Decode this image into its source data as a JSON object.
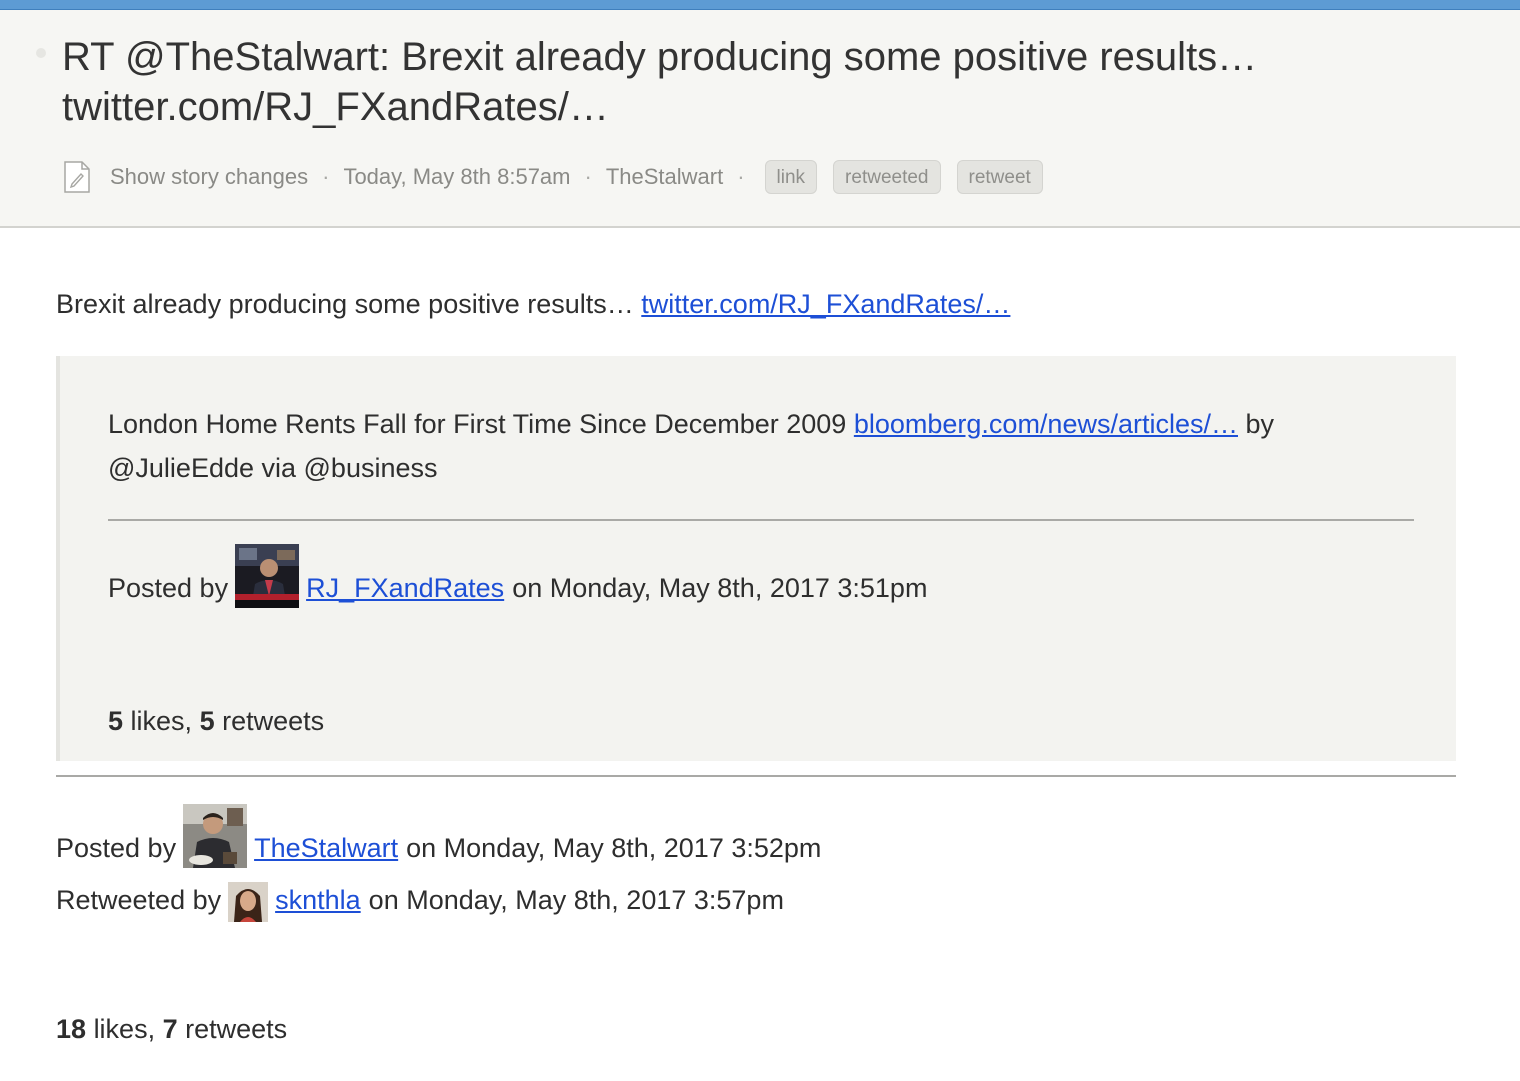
{
  "header": {
    "title": "RT @TheStalwart: Brexit already producing some positive results… twitter.com/RJ_FXandRates/…",
    "meta": {
      "show_changes": "Show story changes",
      "timestamp": "Today, May 8th 8:57am",
      "author": "TheStalwart",
      "separator": "·"
    },
    "tags": [
      "link",
      "retweeted",
      "retweet"
    ]
  },
  "tweet": {
    "text": "Brexit already producing some positive results…",
    "link_text": "twitter.com/RJ_FXandRates/…"
  },
  "quoted": {
    "text_before": "London Home Rents Fall for First Time Since December 2009",
    "link_text": "bloomberg.com/news/articles/…",
    "text_after": "by @JulieEdde via @business",
    "posted_prefix": "Posted by",
    "author": "RJ_FXandRates",
    "posted_suffix": "on Monday, May 8th, 2017 3:51pm",
    "likes": "5",
    "likes_label": "likes,",
    "retweets": "5",
    "retweets_label": "retweets"
  },
  "post": {
    "posted_prefix": "Posted by",
    "author": "TheStalwart",
    "posted_suffix": "on Monday, May 8th, 2017 3:52pm",
    "retweeted_prefix": "Retweeted by",
    "retweeter": "sknthla",
    "retweeted_suffix": "on Monday, May 8th, 2017 3:57pm",
    "likes": "18",
    "likes_label": "likes,",
    "retweets": "7",
    "retweets_label": "retweets"
  },
  "colors": {
    "link": "#1d4fd6",
    "header_bg": "#f6f6f3",
    "quote_bg": "#f3f3f0",
    "top_strip": "#5d9bd4"
  },
  "icons": {
    "show_changes": "document-edit-icon"
  }
}
